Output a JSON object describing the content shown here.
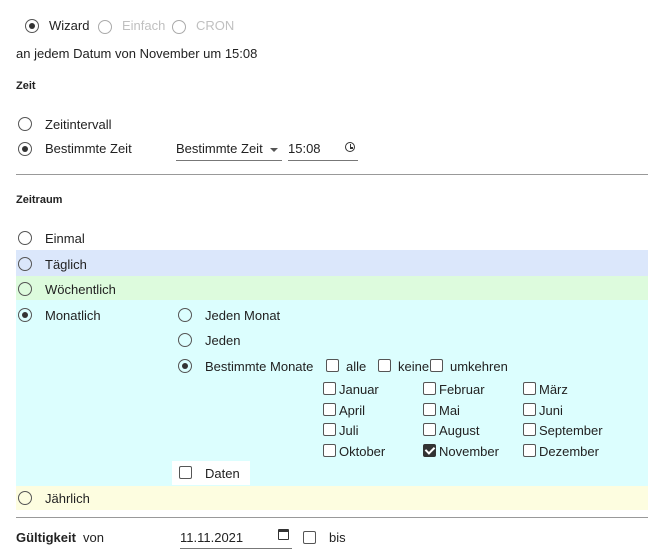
{
  "mode": {
    "wizard": "Wizard",
    "einfach": "Einfach",
    "cron": "CRON"
  },
  "summary": "an jedem Datum von November um 15:08",
  "zeit": {
    "header": "Zeit",
    "option_interval": "Zeitintervall",
    "option_specific": "Bestimmte Zeit",
    "select_value": "Bestimmte Zeit",
    "time_value": "15:08"
  },
  "zeitraum": {
    "header": "Zeitraum",
    "einmal": "Einmal",
    "taeglich": "Täglich",
    "woechentlich": "Wöchentlich",
    "monatlich": "Monatlich",
    "jaehrlich": "Jährlich"
  },
  "monthly": {
    "jeden_monat": "Jeden Monat",
    "jeden": "Jeden",
    "bestimmte_monate": "Bestimmte Monate",
    "alle": "alle",
    "keine": "keine",
    "umkehren": "umkehren",
    "months": [
      "Januar",
      "Februar",
      "März",
      "April",
      "Mai",
      "Juni",
      "Juli",
      "August",
      "September",
      "Oktober",
      "November",
      "Dezember"
    ],
    "checked_month": "November",
    "daten": "Daten"
  },
  "validity": {
    "label": "Gültigkeit",
    "von": "von",
    "date": "11.11.2021",
    "bis": "bis"
  },
  "colors": {
    "blue_band": "#dbe7fb",
    "green_band": "#ddfbdd",
    "cyan_band": "#dcfefe",
    "yellow_band": "#fdfde0"
  }
}
